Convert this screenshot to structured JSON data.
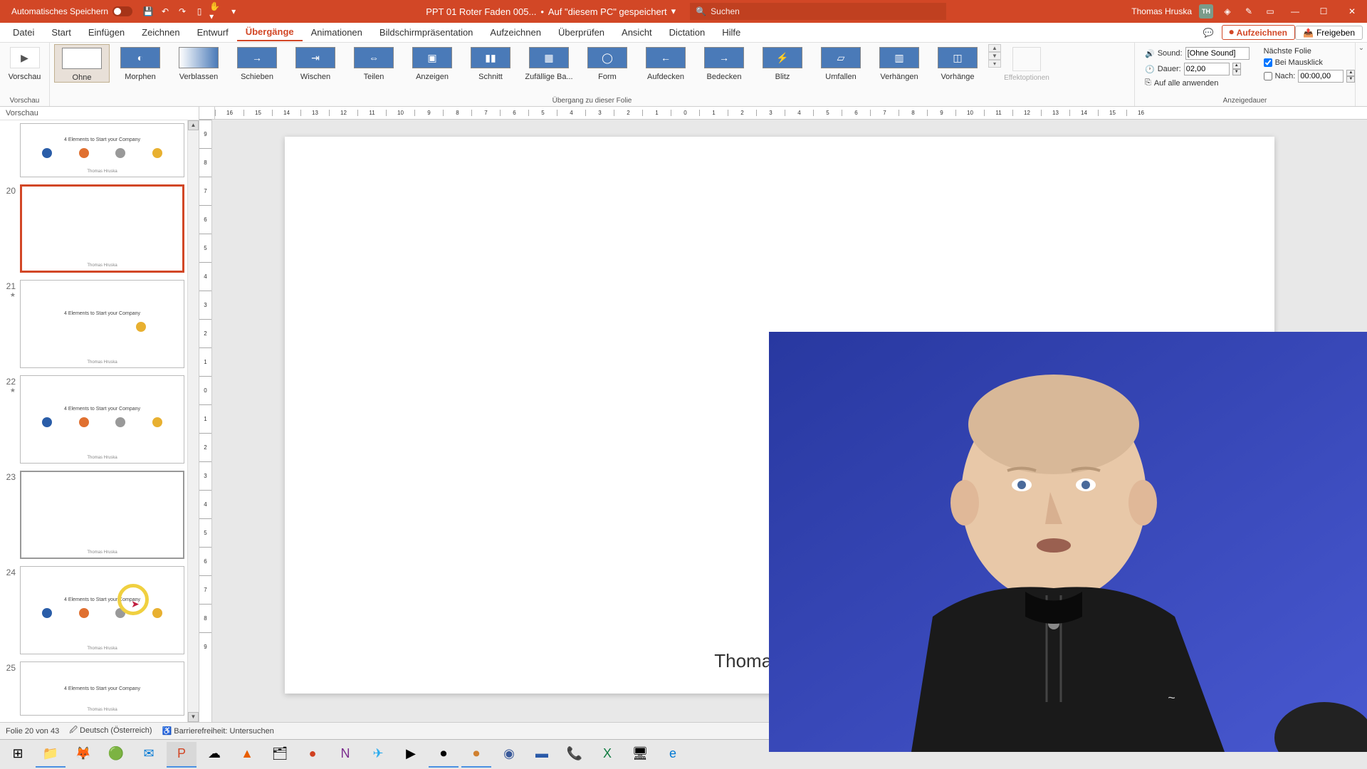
{
  "titlebar": {
    "autosave": "Automatisches Speichern",
    "filename": "PPT 01 Roter Faden 005...",
    "saved_location": "Auf \"diesem PC\" gespeichert",
    "search_placeholder": "Suchen",
    "user_name": "Thomas Hruska",
    "user_initials": "TH"
  },
  "menu": {
    "tabs": [
      "Datei",
      "Start",
      "Einfügen",
      "Zeichnen",
      "Entwurf",
      "Übergänge",
      "Animationen",
      "Bildschirmpräsentation",
      "Aufzeichnen",
      "Überprüfen",
      "Ansicht",
      "Dictation",
      "Hilfe"
    ],
    "active_index": 5,
    "record": "Aufzeichnen",
    "share": "Freigeben"
  },
  "ribbon": {
    "preview_group": "Vorschau",
    "preview_btn": "Vorschau",
    "transitions_group": "Übergang zu dieser Folie",
    "transitions": [
      "Ohne",
      "Morphen",
      "Verblassen",
      "Schieben",
      "Wischen",
      "Teilen",
      "Anzeigen",
      "Schnitt",
      "Zufällige Ba...",
      "Form",
      "Aufdecken",
      "Bedecken",
      "Blitz",
      "Umfallen",
      "Verhängen",
      "Vorhänge"
    ],
    "effect_options": "Effektoptionen",
    "timing_group": "Anzeigedauer",
    "sound_label": "Sound:",
    "sound_value": "[Ohne Sound]",
    "duration_label": "Dauer:",
    "duration_value": "02,00",
    "apply_all": "Auf alle anwenden",
    "advance_label": "Nächste Folie",
    "on_click": "Bei Mausklick",
    "after_label": "Nach:",
    "after_value": "00:00,00"
  },
  "thumbnails": {
    "header": "Vorschau",
    "items": [
      {
        "num": "",
        "title": "4 Elements to Start your Company",
        "type": "elements",
        "partial": true
      },
      {
        "num": "20",
        "title": "",
        "type": "blank",
        "selected": true
      },
      {
        "num": "21",
        "star": true,
        "title": "4 Elements to Start your Company",
        "type": "single-yellow"
      },
      {
        "num": "22",
        "star": true,
        "title": "4 Elements to Start your Company",
        "type": "elements"
      },
      {
        "num": "23",
        "title": "",
        "type": "blank",
        "hover": true
      },
      {
        "num": "24",
        "title": "4 Elements to Start your Company",
        "type": "elements"
      },
      {
        "num": "25",
        "title": "4 Elements to Start your Company",
        "type": "title-only",
        "partial": true
      }
    ],
    "author": "Thomas Hruska"
  },
  "canvas": {
    "author": "Thomas Hruska"
  },
  "ruler": {
    "h": [
      "16",
      "15",
      "14",
      "13",
      "12",
      "11",
      "10",
      "9",
      "8",
      "7",
      "6",
      "5",
      "4",
      "3",
      "2",
      "1",
      "0",
      "1",
      "2",
      "3",
      "4",
      "5",
      "6",
      "7",
      "8",
      "9",
      "10",
      "11",
      "12",
      "13",
      "14",
      "15",
      "16"
    ],
    "v": [
      "9",
      "8",
      "7",
      "6",
      "5",
      "4",
      "3",
      "2",
      "1",
      "0",
      "1",
      "2",
      "3",
      "4",
      "5",
      "6",
      "7",
      "8",
      "9"
    ]
  },
  "statusbar": {
    "slide": "Folie 20 von 43",
    "lang": "Deutsch (Österreich)",
    "access": "Barrierefreiheit: Untersuchen"
  },
  "taskbar_icons": [
    "⊞",
    "📁",
    "🦊",
    "🌐",
    "✉",
    "📊",
    "☁",
    "🔥",
    "🗂",
    "🟥",
    "📓",
    "✈",
    "▶",
    "⏺",
    "⏺",
    "🟦",
    "🟦",
    "📞",
    "📗",
    "🖥",
    "🌐"
  ]
}
